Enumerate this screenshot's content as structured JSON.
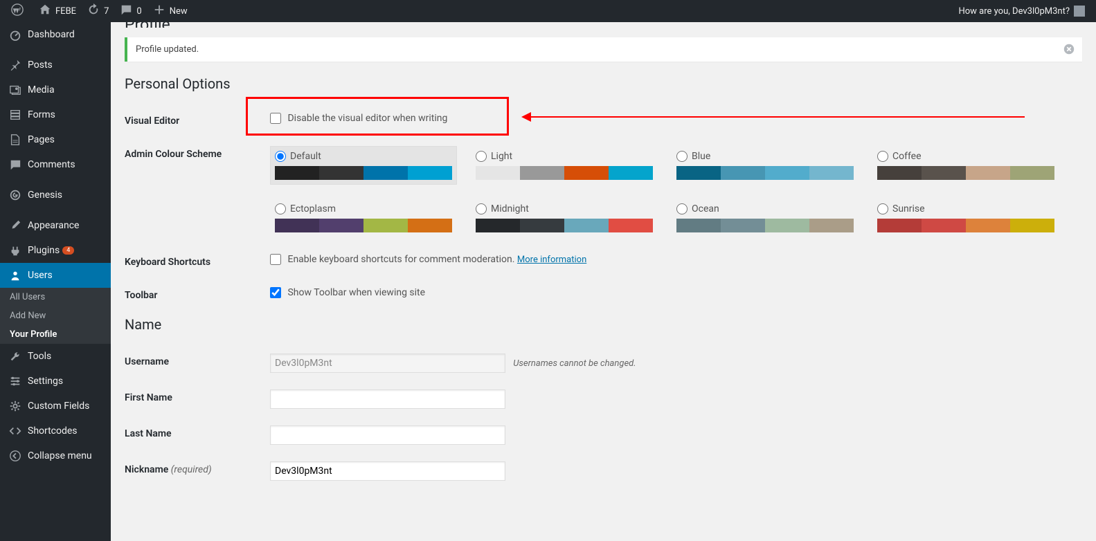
{
  "toolbar": {
    "site": "FEBE",
    "updates": "7",
    "comments": "0",
    "newLabel": "New",
    "greeting": "How are you, Dev3l0pM3nt?"
  },
  "menu": {
    "dashboard": "Dashboard",
    "posts": "Posts",
    "media": "Media",
    "forms": "Forms",
    "pages": "Pages",
    "comments": "Comments",
    "genesis": "Genesis",
    "appearance": "Appearance",
    "plugins": "Plugins",
    "pluginsBadge": "4",
    "users": "Users",
    "tools": "Tools",
    "settings": "Settings",
    "customFields": "Custom Fields",
    "shortcodes": "Shortcodes",
    "collapse": "Collapse menu"
  },
  "usersSub": {
    "allUsers": "All Users",
    "addNew": "Add New",
    "yourProfile": "Your Profile"
  },
  "page": {
    "title": "Profile",
    "notice": "Profile updated."
  },
  "sections": {
    "personal": "Personal Options",
    "name": "Name"
  },
  "labels": {
    "visualEditor": "Visual Editor",
    "visualEditorCheckbox": "Disable the visual editor when writing",
    "adminColor": "Admin Colour Scheme",
    "keyboard": "Keyboard Shortcuts",
    "keyboardCheckbox": "Enable keyboard shortcuts for comment moderation.",
    "moreInfo": "More information",
    "toolbar": "Toolbar",
    "toolbarCheckbox": "Show Toolbar when viewing site",
    "username": "Username",
    "usernameNote": "Usernames cannot be changed.",
    "firstName": "First Name",
    "lastName": "Last Name",
    "nickname": "Nickname",
    "required": "(required)"
  },
  "fields": {
    "username": "Dev3l0pM3nt",
    "firstName": "",
    "lastName": "",
    "nickname": "Dev3l0pM3nt"
  },
  "schemes": [
    {
      "name": "Default",
      "selected": true,
      "colors": [
        "#222222",
        "#333333",
        "#0073aa",
        "#00a0d2"
      ]
    },
    {
      "name": "Light",
      "selected": false,
      "colors": [
        "#e5e5e5",
        "#999999",
        "#d64e07",
        "#04a4cc"
      ]
    },
    {
      "name": "Blue",
      "selected": false,
      "colors": [
        "#096484",
        "#4796b3",
        "#52accc",
        "#74b6ce"
      ]
    },
    {
      "name": "Coffee",
      "selected": false,
      "colors": [
        "#46403c",
        "#59524c",
        "#c7a589",
        "#9ea476"
      ]
    },
    {
      "name": "Ectoplasm",
      "selected": false,
      "colors": [
        "#413256",
        "#523f6d",
        "#a3b745",
        "#d46f15"
      ]
    },
    {
      "name": "Midnight",
      "selected": false,
      "colors": [
        "#25282b",
        "#363b3f",
        "#69a8bb",
        "#e14d43"
      ]
    },
    {
      "name": "Ocean",
      "selected": false,
      "colors": [
        "#627c83",
        "#738e96",
        "#9ebaa0",
        "#aa9d88"
      ]
    },
    {
      "name": "Sunrise",
      "selected": false,
      "colors": [
        "#b43c38",
        "#cf4944",
        "#dd823b",
        "#ccaf0b"
      ]
    }
  ]
}
